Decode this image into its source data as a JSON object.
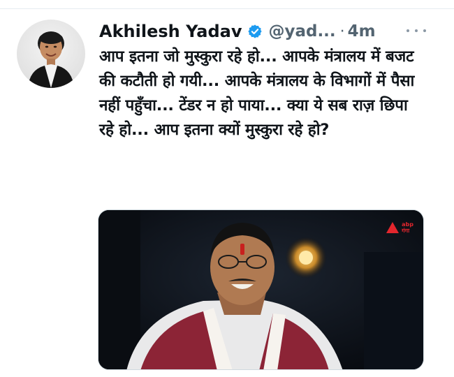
{
  "tweet": {
    "author_name": "Akhilesh Yadav",
    "handle": "@yad...",
    "separator": "·",
    "time": "4m",
    "verified": true,
    "text": "आप इतना जो मुस्कुरा रहे हो... आपके मंत्रालय में बजट की कटौती हो गयी... आपके मंत्रालय के विभागों में पैसा नहीं पहुँचा... टेंडर न हो पाया... क्या ये सब राज़ छिपा रहे हो... आप इतना क्यों मुस्कुरा रहे हो?",
    "media": {
      "watermark_line1": "abp",
      "watermark_line2": "गंगा"
    }
  },
  "icons": {
    "verified": "verified-badge-icon",
    "more": "more-horizontal-icon"
  },
  "colors": {
    "verified_blue": "#1d9bf0",
    "secondary_text": "#536471",
    "watermark_red": "#e3262d"
  }
}
